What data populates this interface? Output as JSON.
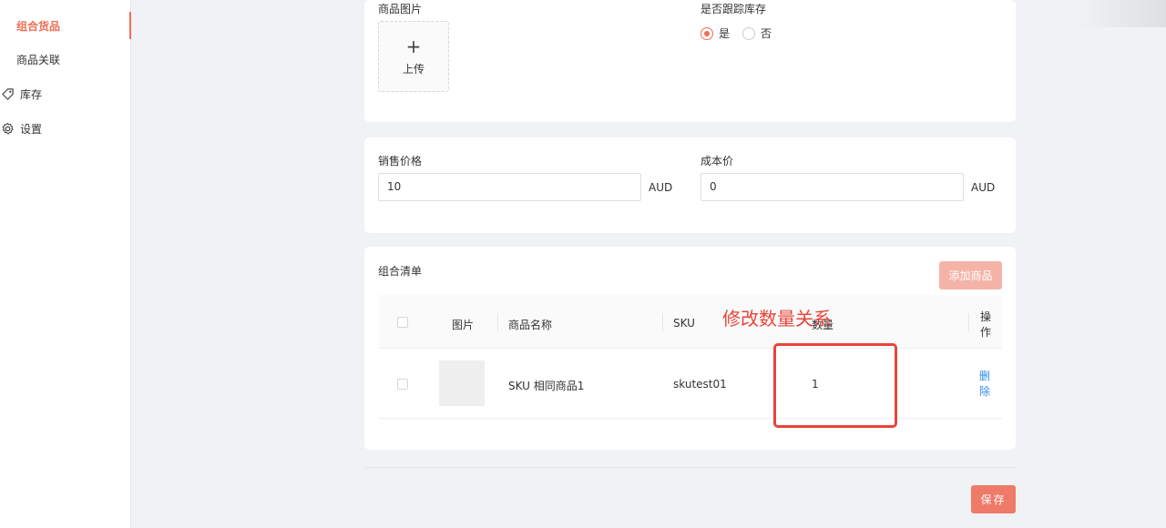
{
  "sidebar": {
    "items": [
      {
        "label": "组合货品",
        "active": true
      },
      {
        "label": "商品关联"
      },
      {
        "label": "库存",
        "icon": "tag-icon"
      },
      {
        "label": "设置",
        "icon": "gear-icon"
      }
    ]
  },
  "basic": {
    "image_label": "商品图片",
    "upload_plus": "+",
    "upload_text": "上传",
    "track_label": "是否跟踪库存",
    "options": [
      {
        "label": "是",
        "checked": true
      },
      {
        "label": "否",
        "checked": false
      }
    ]
  },
  "price": {
    "sale_label": "销售价格",
    "sale_value": "10",
    "sale_unit": "AUD",
    "cost_label": "成本价",
    "cost_value": "0",
    "cost_unit": "AUD"
  },
  "combo": {
    "title": "组合清单",
    "add_button": "添加商品",
    "columns": {
      "image": "图片",
      "name": "商品名称",
      "sku": "SKU",
      "quantity": "数量",
      "action_1": "操",
      "action_2": "作"
    },
    "rows": [
      {
        "name": "SKU 相同商品1",
        "sku": "skutest01",
        "quantity": "1",
        "delete_1": "删",
        "delete_2": "除"
      }
    ]
  },
  "footer": {
    "save_button": "保存"
  },
  "annotation": {
    "text": "修改数量关系"
  },
  "colors": {
    "accent": "#ee6f57",
    "annotation": "#e8443a",
    "link": "#2d8cf0"
  }
}
